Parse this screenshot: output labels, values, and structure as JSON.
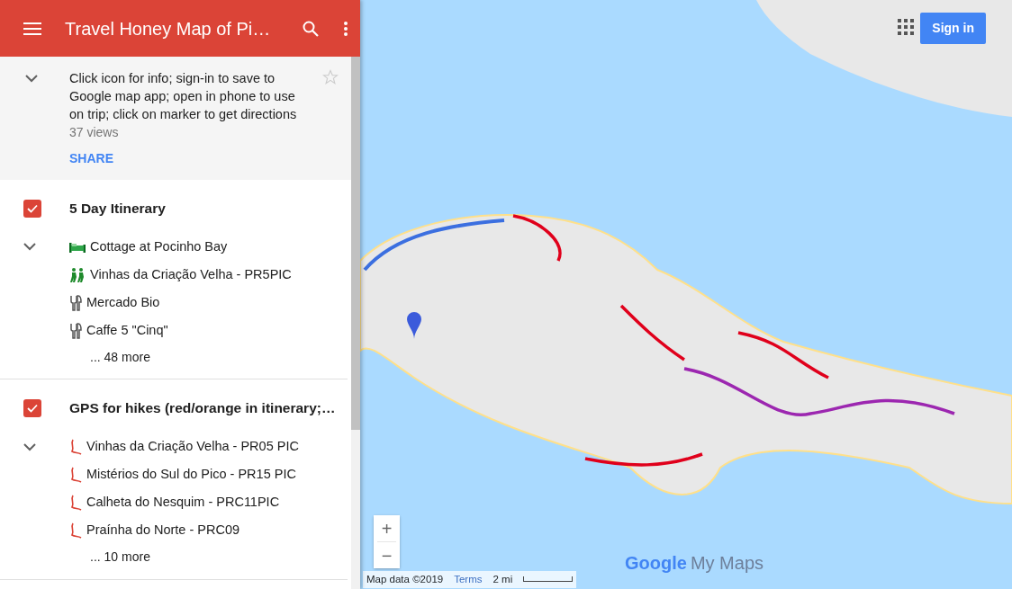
{
  "header": {
    "title": "Travel Honey Map of Pi…"
  },
  "info": {
    "description": "Click icon for info; sign-in to save to Google map app; open in phone to use on trip; click on marker to get directions",
    "views": "37 views",
    "share": "SHARE",
    "starred": false
  },
  "layers": [
    {
      "title": "5 Day Itinerary",
      "checked": true,
      "expanded": true,
      "more": "... 48 more",
      "items": [
        {
          "kind": "bed",
          "label": "Cottage at Pocinho Bay"
        },
        {
          "kind": "hikers",
          "label": "Vinhas da Criação Velha - PR5PIC"
        },
        {
          "kind": "restaurant",
          "label": "Mercado Bio"
        },
        {
          "kind": "restaurant",
          "label": "Caffe 5 \"Cinq\""
        }
      ]
    },
    {
      "title": "GPS for hikes (red/orange in itinerary;…",
      "checked": true,
      "expanded": true,
      "more": "... 10 more",
      "items": [
        {
          "kind": "route",
          "label": "Vinhas da Criação Velha - PR05 PIC"
        },
        {
          "kind": "route",
          "label": "Mistérios do Sul do Pico - PR15 PIC"
        },
        {
          "kind": "route",
          "label": "Calheta do Nesquim - PRC11PIC"
        },
        {
          "kind": "route",
          "label": "Praínha do Norte - PRC09"
        }
      ]
    }
  ],
  "map": {
    "sign_in": "Sign in",
    "zoom_in": "+",
    "zoom_out": "−",
    "map_data": "Map data ©2019",
    "terms": "Terms",
    "scale": "2 mi",
    "logo_brand": "Google",
    "logo_product": "My Maps"
  }
}
